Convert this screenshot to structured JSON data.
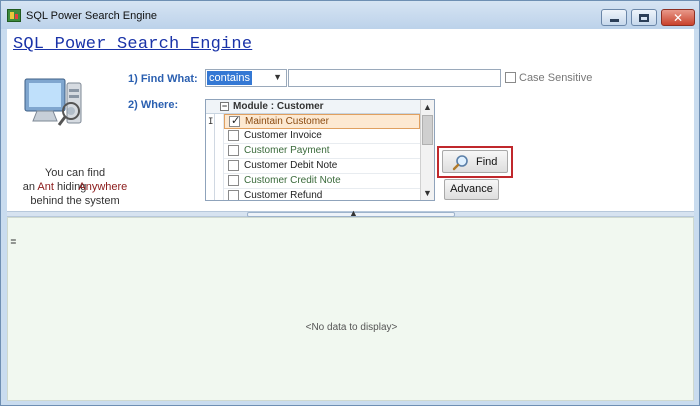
{
  "window": {
    "title": "SQL Power Search Engine"
  },
  "app": {
    "heading": "SQL Power Search Engine"
  },
  "tagline": {
    "line1": "You can find",
    "prefix": "an",
    "ant": "Ant",
    "hiding": "hiding",
    "anywhere": "Anywhere",
    "line3": "behind the system"
  },
  "find": {
    "label": "1) Find What:",
    "mode": "contains",
    "value": "",
    "case_sensitive_label": "Case Sensitive",
    "case_sensitive": false
  },
  "where": {
    "label": "2) Where:",
    "module_header": "Module : Customer",
    "items": [
      {
        "label": "Maintain Customer",
        "checked": true,
        "selected": true
      },
      {
        "label": "Customer Invoice",
        "checked": false
      },
      {
        "label": "Customer Payment",
        "checked": false
      },
      {
        "label": "Customer Debit Note",
        "checked": false
      },
      {
        "label": "Customer Credit Note",
        "checked": false
      },
      {
        "label": "Customer Refund",
        "checked": false
      }
    ]
  },
  "buttons": {
    "find": "Find",
    "advance": "Advance"
  },
  "grid": {
    "empty_text": "<No data to display>"
  },
  "colors": {
    "heading": "#1a33a8",
    "label": "#2a5fb0",
    "highlight": "#c0282c",
    "grid_bg": "#f1f8f0"
  }
}
